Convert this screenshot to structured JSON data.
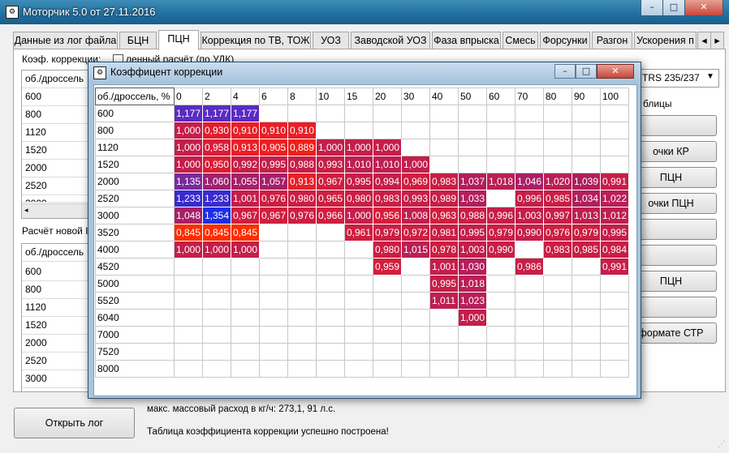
{
  "window": {
    "title": "Моторчик 5.0 от 27.11.2016",
    "buttons": [
      "–",
      "□",
      "✕"
    ]
  },
  "tabs": [
    "Данные из лог файла",
    "БЦН",
    "ПЦН",
    "Коррекция по ТВ, ТОЖ",
    "УОЗ",
    "Заводской УОЗ",
    "Фаза впрыска",
    "Смесь",
    "Форсунки",
    "Разгон",
    "Ускорения п"
  ],
  "tab_scroll": [
    "◂",
    "▸"
  ],
  "left_panel": {
    "coef_label": "Коэф. коррекции:",
    "checkbox_label": "ленный расчёт (по УДК)",
    "grid_header": "об./дроссель",
    "grid_rows": [
      "600",
      "800",
      "1120",
      "1520",
      "2000",
      "2520",
      "3000"
    ],
    "new_calc_label": "Расчёт новой I",
    "grid2_header": "об./дроссель",
    "grid2_rows": [
      "600",
      "800",
      "1120",
      "1520",
      "2000",
      "2520",
      "3000"
    ]
  },
  "right_panel": {
    "dropdown_value": "TRS 235/237",
    "label_tables": "блицы",
    "buttons": [
      "",
      "очки КР",
      "ПЦН",
      "очки ПЦН",
      "",
      "",
      "ПЦН",
      "",
      "формате СТР"
    ]
  },
  "bottom": {
    "open_log": "Открыть лог",
    "max_flow": "макс. массовый расход в кг/ч: 273,1, 91 л.с.",
    "status": "Таблица коэффициента коррекции успешно построена!"
  },
  "dialog": {
    "title": "Коэффицент коррекции",
    "buttons": [
      "–",
      "□",
      "✕"
    ],
    "corner": "об./дроссель, %",
    "columns": [
      "0",
      "2",
      "4",
      "6",
      "8",
      "10",
      "15",
      "20",
      "30",
      "40",
      "50",
      "60",
      "70",
      "80",
      "90",
      "100"
    ],
    "rows": [
      {
        "rpm": "600",
        "cells": [
          "1,177",
          "1,177",
          "1,177",
          "",
          "",
          "",
          "",
          "",
          "",
          "",
          "",
          "",
          "",
          "",
          "",
          ""
        ],
        "colors": [
          "#5a2bc4",
          "#5a2bc4",
          "#5a2bc4",
          "",
          "",
          "",
          "",
          "",
          "",
          "",
          "",
          "",
          "",
          "",
          "",
          ""
        ]
      },
      {
        "rpm": "800",
        "cells": [
          "1,000",
          "0,930",
          "0,910",
          "0,910",
          "0,910",
          "",
          "",
          "",
          "",
          "",
          "",
          "",
          "",
          "",
          "",
          ""
        ],
        "colors": [
          "#c41e4a",
          "#e21d2d",
          "#e81f27",
          "#e81f27",
          "#e81f27",
          "",
          "",
          "",
          "",
          "",
          "",
          "",
          "",
          "",
          "",
          ""
        ]
      },
      {
        "rpm": "1120",
        "cells": [
          "1,000",
          "0,958",
          "0,913",
          "0,905",
          "0,889",
          "1,000",
          "1,000",
          "1,000",
          "",
          "",
          "",
          "",
          "",
          "",
          "",
          ""
        ],
        "colors": [
          "#c41e4a",
          "#d81d38",
          "#e81f27",
          "#ea1f22",
          "#ef2018",
          "#c41e4a",
          "#c41e4a",
          "#c41e4a",
          "",
          "",
          "",
          "",
          "",
          "",
          "",
          ""
        ]
      },
      {
        "rpm": "1520",
        "cells": [
          "1,000",
          "0,950",
          "0,992",
          "0,995",
          "0,988",
          "0,993",
          "1,010",
          "1,010",
          "1,000",
          "",
          "",
          "",
          "",
          "",
          "",
          ""
        ],
        "colors": [
          "#c41e4a",
          "#db1d34",
          "#c71e47",
          "#c51e49",
          "#c81e46",
          "#c71e47",
          "#bd1f51",
          "#bd1f51",
          "#c41e4a",
          "",
          "",
          "",
          "",
          "",
          "",
          ""
        ]
      },
      {
        "rpm": "2000",
        "cells": [
          "1,135",
          "1,060",
          "1,055",
          "1,057",
          "0,913",
          "0,967",
          "0,995",
          "0,994",
          "0,969",
          "0,983",
          "1,037",
          "1,018",
          "1,046",
          "1,020",
          "1,039",
          "0,991"
        ],
        "colors": [
          "#7a2a9c",
          "#a22070",
          "#a52069",
          "#a4206b",
          "#e81f27",
          "#d01e3f",
          "#c51e49",
          "#c51e49",
          "#cf1e40",
          "#ca1e45",
          "#b11f5c",
          "#ba1f55",
          "#aa1f65",
          "#b91f56",
          "#b01f5c",
          "#c71e48"
        ]
      },
      {
        "rpm": "2520",
        "cells": [
          "1,233",
          "1,233",
          "1,001",
          "0,976",
          "0,980",
          "0,965",
          "0,980",
          "0,983",
          "0,993",
          "0,989",
          "1,033",
          "",
          "0,996",
          "0,985",
          "1,034",
          "1,022"
        ],
        "colors": [
          "#3a2ad0",
          "#3a2ad0",
          "#c41e4a",
          "#cd1e42",
          "#cb1e44",
          "#d01e3f",
          "#cb1e44",
          "#ca1e45",
          "#c71e47",
          "#c81e46",
          "#b31f5b",
          "",
          "#c61e48",
          "#c91e45",
          "#b21f5b",
          "#b81f56"
        ]
      },
      {
        "rpm": "3000",
        "cells": [
          "1,048",
          "1,354",
          "0,967",
          "0,967",
          "0,976",
          "0,966",
          "1,000",
          "0,956",
          "1,008",
          "0,963",
          "0,988",
          "0,996",
          "1,003",
          "0,997",
          "1,013",
          "1,012"
        ],
        "colors": [
          "#a81f67",
          "#1c2ee8",
          "#d01e3f",
          "#d01e3f",
          "#cd1e42",
          "#d01e3f",
          "#c41e4a",
          "#d41e3b",
          "#c11e4d",
          "#d11e3e",
          "#c81e46",
          "#c61e48",
          "#c31e4b",
          "#c51e49",
          "#bd1f51",
          "#be1f50"
        ]
      },
      {
        "rpm": "3520",
        "cells": [
          "0,845",
          "0,845",
          "0,845",
          "",
          "",
          "",
          "0,961",
          "0,979",
          "0,972",
          "0,981",
          "0,995",
          "0,979",
          "0,990",
          "0,976",
          "0,979",
          "0,995"
        ],
        "colors": [
          "#fe2d00",
          "#fe2d00",
          "#fe2d00",
          "",
          "",
          "",
          "#d11e3e",
          "#cc1e43",
          "#ce1e41",
          "#cb1e44",
          "#c51e49",
          "#cc1e43",
          "#c81e47",
          "#cd1e42",
          "#cc1e43",
          "#c51e49"
        ]
      },
      {
        "rpm": "4000",
        "cells": [
          "1,000",
          "1,000",
          "1,000",
          "",
          "",
          "",
          "",
          "0,980",
          "1,015",
          "0,978",
          "1,003",
          "0,990",
          "",
          "0,983",
          "0,985",
          "0,984"
        ],
        "colors": [
          "#c41e4a",
          "#c41e4a",
          "#c41e4a",
          "",
          "",
          "",
          "",
          "#cb1e44",
          "#bb1f53",
          "#cc1e43",
          "#c31e4b",
          "#c81e47",
          "",
          "#ca1e45",
          "#c91e45",
          "#c91e45"
        ]
      },
      {
        "rpm": "4520",
        "cells": [
          "",
          "",
          "",
          "",
          "",
          "",
          "",
          "0,959",
          "",
          "1,001",
          "1,030",
          "",
          "0,986",
          "",
          "",
          "0,991"
        ],
        "colors": [
          "",
          "",
          "",
          "",
          "",
          "",
          "",
          "#d31e3c",
          "",
          "#c41e4a",
          "#b41f5a",
          "",
          "#c91e46",
          "",
          "",
          "#c71e48"
        ]
      },
      {
        "rpm": "5000",
        "cells": [
          "",
          "",
          "",
          "",
          "",
          "",
          "",
          "",
          "",
          "0,995",
          "1,018",
          "",
          "",
          "",
          "",
          ""
        ],
        "colors": [
          "",
          "",
          "",
          "",
          "",
          "",
          "",
          "",
          "",
          "#c51e49",
          "#ba1f55",
          "",
          "",
          "",
          "",
          ""
        ]
      },
      {
        "rpm": "5520",
        "cells": [
          "",
          "",
          "",
          "",
          "",
          "",
          "",
          "",
          "",
          "1,011",
          "1,023",
          "",
          "",
          "",
          "",
          ""
        ],
        "colors": [
          "",
          "",
          "",
          "",
          "",
          "",
          "",
          "",
          "",
          "#bd1f51",
          "#b71f57",
          "",
          "",
          "",
          "",
          ""
        ]
      },
      {
        "rpm": "6040",
        "cells": [
          "",
          "",
          "",
          "",
          "",
          "",
          "",
          "",
          "",
          "",
          "1,000",
          "",
          "",
          "",
          "",
          ""
        ],
        "colors": [
          "",
          "",
          "",
          "",
          "",
          "",
          "",
          "",
          "",
          "",
          "#c41e4a",
          "",
          "",
          "",
          "",
          ""
        ]
      },
      {
        "rpm": "7000",
        "cells": [
          "",
          "",
          "",
          "",
          "",
          "",
          "",
          "",
          "",
          "",
          "",
          "",
          "",
          "",
          "",
          ""
        ],
        "colors": [
          "",
          "",
          "",
          "",
          "",
          "",
          "",
          "",
          "",
          "",
          "",
          "",
          "",
          "",
          "",
          ""
        ]
      },
      {
        "rpm": "7520",
        "cells": [
          "",
          "",
          "",
          "",
          "",
          "",
          "",
          "",
          "",
          "",
          "",
          "",
          "",
          "",
          "",
          ""
        ],
        "colors": [
          "",
          "",
          "",
          "",
          "",
          "",
          "",
          "",
          "",
          "",
          "",
          "",
          "",
          "",
          "",
          ""
        ]
      },
      {
        "rpm": "8000",
        "cells": [
          "",
          "",
          "",
          "",
          "",
          "",
          "",
          "",
          "",
          "",
          "",
          "",
          "",
          "",
          "",
          ""
        ],
        "colors": [
          "",
          "",
          "",
          "",
          "",
          "",
          "",
          "",
          "",
          "",
          "",
          "",
          "",
          "",
          "",
          ""
        ]
      }
    ]
  }
}
